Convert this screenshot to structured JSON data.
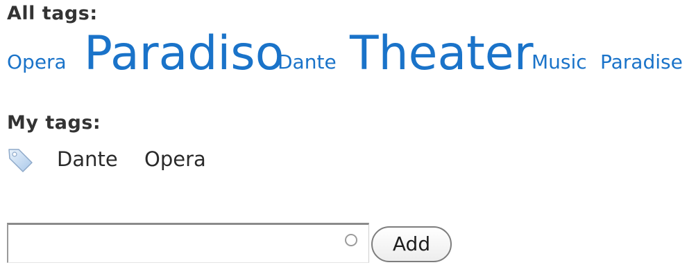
{
  "all_tags": {
    "heading": "All tags:",
    "tags": [
      {
        "label": "Opera",
        "weight": "small"
      },
      {
        "label": "Paradiso",
        "weight": "large"
      },
      {
        "label": "Dante",
        "weight": "small"
      },
      {
        "label": "Theater",
        "weight": "large"
      },
      {
        "label": "Music",
        "weight": "small"
      },
      {
        "label": "Paradise",
        "weight": "small"
      }
    ]
  },
  "my_tags": {
    "heading": "My tags:",
    "icon": "tag-icon",
    "tags": [
      "Dante",
      "Opera"
    ]
  },
  "add_form": {
    "input_value": "",
    "input_placeholder": "",
    "button_label": "Add"
  },
  "colors": {
    "link": "#1a73c9",
    "heading": "#333333",
    "text": "#2a2a2a"
  }
}
